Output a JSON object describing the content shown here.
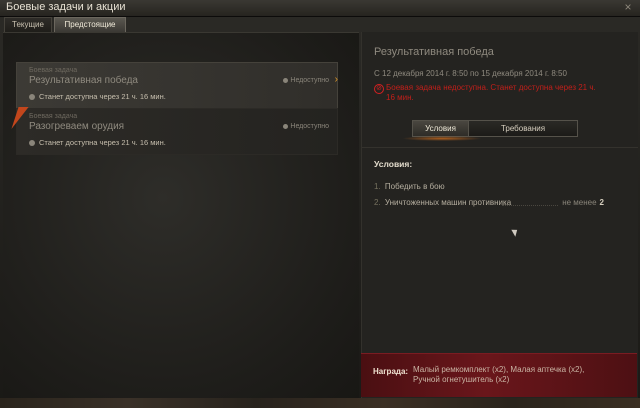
{
  "window": {
    "title": "Боевые задачи и акции",
    "close_glyph": "×"
  },
  "tabs": [
    {
      "label": "Текущие",
      "active": false
    },
    {
      "label": "Предстоящие",
      "active": true
    }
  ],
  "quests": [
    {
      "category": "Боевая задача",
      "name": "Результативная победа",
      "status": "Станет доступна через 21 ч. 16 мин.",
      "availability": "Недоступно",
      "selected": true,
      "arrow": "›"
    },
    {
      "category": "Боевая задача",
      "name": "Разогреваем орудия",
      "status": "Станет доступна через 21 ч. 16 мин.",
      "availability": "Недоступно",
      "selected": false
    }
  ],
  "detail": {
    "title": "Результативная победа",
    "dates": "С 12 декабря 2014 г. 8:50 по 15 декабря 2014 г. 8:50",
    "warning": "Боевая задача недоступна. Станет доступна через 21 ч. 16 мин.",
    "buttons": {
      "conditions": "Условия",
      "requirements": "Требования"
    },
    "conditions_heading": "Условия:",
    "conditions": [
      {
        "num": "1.",
        "text": "Победить в бою"
      },
      {
        "num": "2.",
        "text": "Уничтоженных машин противника",
        "req_label": "не менее",
        "req_value": "2"
      }
    ],
    "reward_label": "Награда:",
    "reward_text": "Малый ремкомплект (x2), Малая аптечка (x2), Ручной огнетушитель (x2)"
  },
  "colors": {
    "accent": "#e09a2a",
    "warning": "#c21f1a",
    "reward_bg": "#6a161b"
  }
}
